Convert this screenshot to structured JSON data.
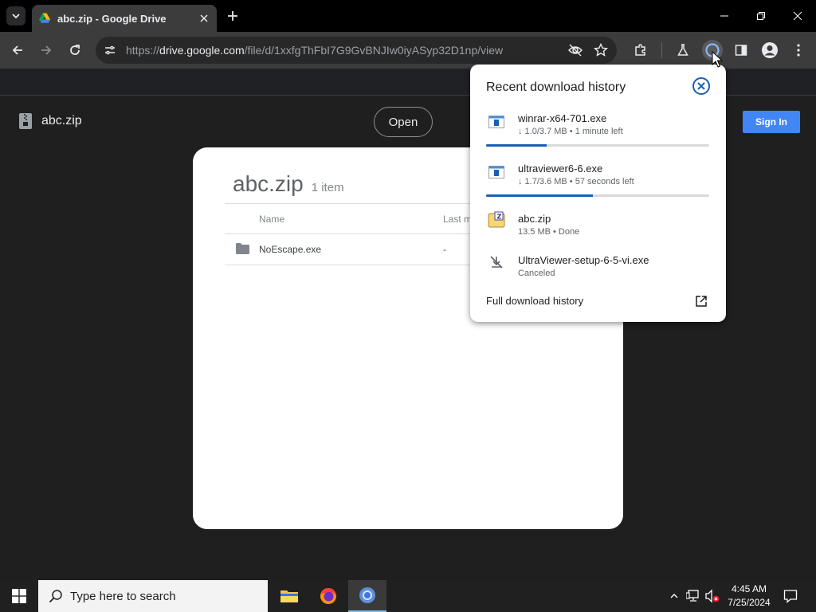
{
  "browser": {
    "tab": {
      "title": "abc.zip - Google Drive"
    },
    "address": {
      "scheme": "https://",
      "host": "drive.google.com",
      "path": "/file/d/1xxfgThFbI7G9GvBNJIw0iyASyp32D1np/view"
    }
  },
  "drive": {
    "file_name": "abc.zip",
    "open_label": "Open",
    "signin_label": "Sign In",
    "card": {
      "title": "abc.zip",
      "item_count": "1 item",
      "columns": {
        "name": "Name",
        "last_modified": "Last m"
      },
      "rows": [
        {
          "name": "NoEscape.exe",
          "modified": "-"
        }
      ]
    }
  },
  "downloads": {
    "title": "Recent download history",
    "items": [
      {
        "name": "winrar-x64-701.exe",
        "status": "↓ 1.0/3.7 MB • 1 minute left",
        "progress": 0.27
      },
      {
        "name": "ultraviewer6-6.exe",
        "status": "↓ 1.7/3.6 MB • 57 seconds left",
        "progress": 0.48
      },
      {
        "name": "abc.zip",
        "status": "13.5 MB • Done"
      },
      {
        "name": "UltraViewer-setup-6-5-vi.exe",
        "status": "Canceled"
      }
    ],
    "footer": "Full download history"
  },
  "taskbar": {
    "search_placeholder": "Type here to search",
    "time": "4:45 AM",
    "date": "7/25/2024"
  },
  "colors": {
    "accent_blue": "#1a5fb4",
    "signin_blue": "#4285f4"
  }
}
